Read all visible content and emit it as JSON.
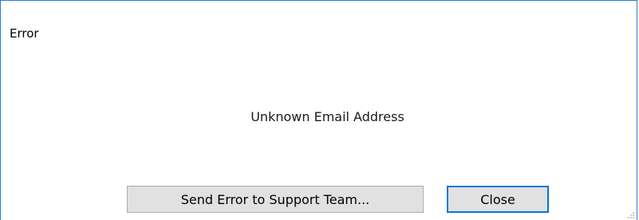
{
  "dialog": {
    "title": "Error",
    "message": "Unknown Email Address",
    "buttons": {
      "send_label": "Send Error to Support Team...",
      "close_label": "Close"
    }
  },
  "colors": {
    "border_accent": "#1f7fd6",
    "focus_border": "#0078d7",
    "button_face": "#e1e1e1"
  },
  "icons": {
    "resize_grip": "size-grip-icon"
  }
}
